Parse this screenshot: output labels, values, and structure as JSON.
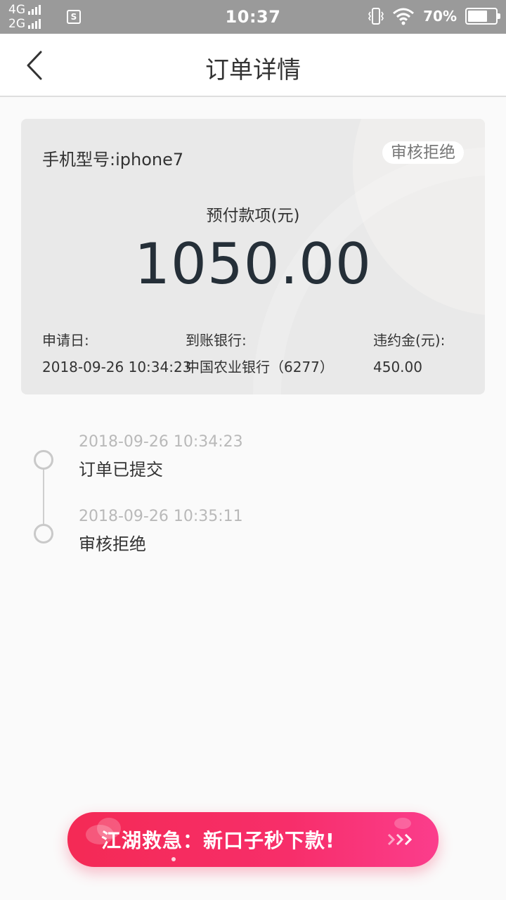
{
  "status_bar": {
    "network_1": "4G",
    "network_2": "2G",
    "sim_badge": "S",
    "time": "10:37",
    "battery": "70%",
    "battery_level": 0.7,
    "icons": [
      "signal-icon",
      "sim-icon",
      "vibrate-icon",
      "wifi-icon",
      "battery-icon"
    ]
  },
  "header": {
    "title": "订单详情",
    "back_icon": "chevron-left-icon"
  },
  "card": {
    "model": "手机型号:iphone7",
    "status_badge": "审核拒绝",
    "amount_label": "预付款项(元)",
    "amount": "1050.00",
    "apply_date_label": "申请日:",
    "apply_date": "2018-09-26 10:34:23",
    "bank_label": "到账银行:",
    "bank": "中国农业银行（6277）",
    "penalty_label": "违约金(元):",
    "penalty": "450.00"
  },
  "timeline": [
    {
      "time": "2018-09-26 10:34:23",
      "text": "订单已提交"
    },
    {
      "time": "2018-09-26 10:35:11",
      "text": "审核拒绝"
    }
  ],
  "banner": {
    "text": "江湖救急：新口子秒下款!",
    "icon": "triple-chevron-right-icon"
  },
  "colors": {
    "status_bar_bg": "#9a9a9a",
    "amount_text": "#252f38",
    "banner_start": "#f42a55",
    "banner_end": "#fb3d8c"
  }
}
